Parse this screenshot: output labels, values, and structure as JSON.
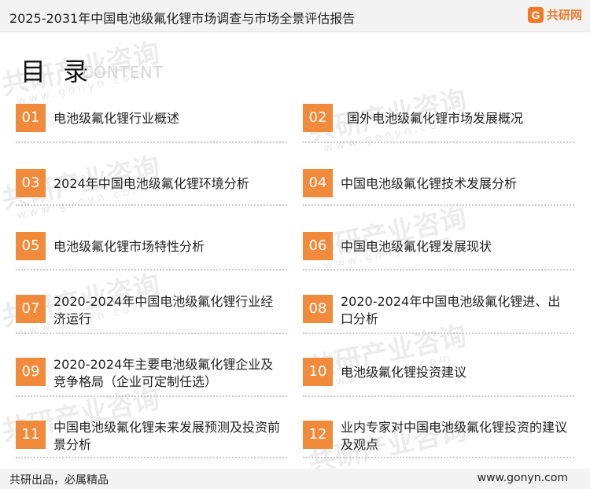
{
  "header": {
    "title": "2025-2031年中国电池级氟化锂市场调查与市场全景评估报告",
    "brand_mark": "G",
    "brand_name": "共研网"
  },
  "watermark": {
    "text": "共研产业咨询",
    "url_text": "www.gonyn.com"
  },
  "toc": {
    "title": "目 录",
    "subtitle": "CONTENT",
    "items": [
      {
        "num": "01",
        "label": "电池级氟化锂行业概述"
      },
      {
        "num": "02",
        "label": "国外电池级氟化锂市场发展概况"
      },
      {
        "num": "03",
        "label": "2024年中国电池级氟化锂环境分析"
      },
      {
        "num": "04",
        "label": "中国电池级氟化锂技术发展分析"
      },
      {
        "num": "05",
        "label": "电池级氟化锂市场特性分析"
      },
      {
        "num": "06",
        "label": "中国电池级氟化锂发展现状"
      },
      {
        "num": "07",
        "label": "2020-2024年中国电池级氟化锂行业经济运行"
      },
      {
        "num": "08",
        "label": "2020-2024年中国电池级氟化锂进、出口分析"
      },
      {
        "num": "09",
        "label": "2020-2024年主要电池级氟化锂企业及竞争格局（企业可定制任选）"
      },
      {
        "num": "10",
        "label": "电池级氟化锂投资建议"
      },
      {
        "num": "11",
        "label": "中国电池级氟化锂未来发展预测及投资前景分析"
      },
      {
        "num": "12",
        "label": "业内专家对中国电池级氟化锂投资的建议及观点"
      }
    ]
  },
  "footer": {
    "left": "共研出品，必属精品",
    "right": "www.gonyn.com"
  }
}
